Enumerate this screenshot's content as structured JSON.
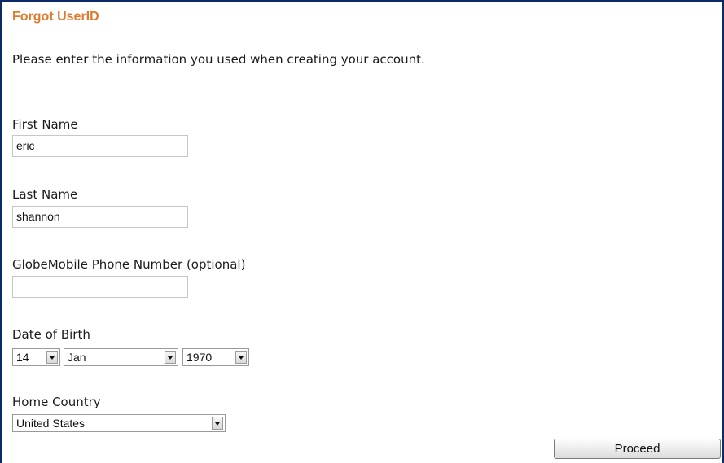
{
  "page": {
    "title": "Forgot UserID",
    "intro": "Please enter the information you used when creating your account."
  },
  "form": {
    "first_name": {
      "label": "First Name",
      "value": "eric"
    },
    "last_name": {
      "label": "Last Name",
      "value": "shannon"
    },
    "phone": {
      "label": "GlobeMobile Phone Number (optional)",
      "value": ""
    },
    "dob": {
      "label": "Date of Birth",
      "day": "14",
      "month": "Jan",
      "year": "1970"
    },
    "country": {
      "label": "Home Country",
      "value": "United States"
    },
    "proceed_label": "Proceed"
  },
  "colors": {
    "title": "#e07a2e",
    "frame": "#0b2a66"
  }
}
